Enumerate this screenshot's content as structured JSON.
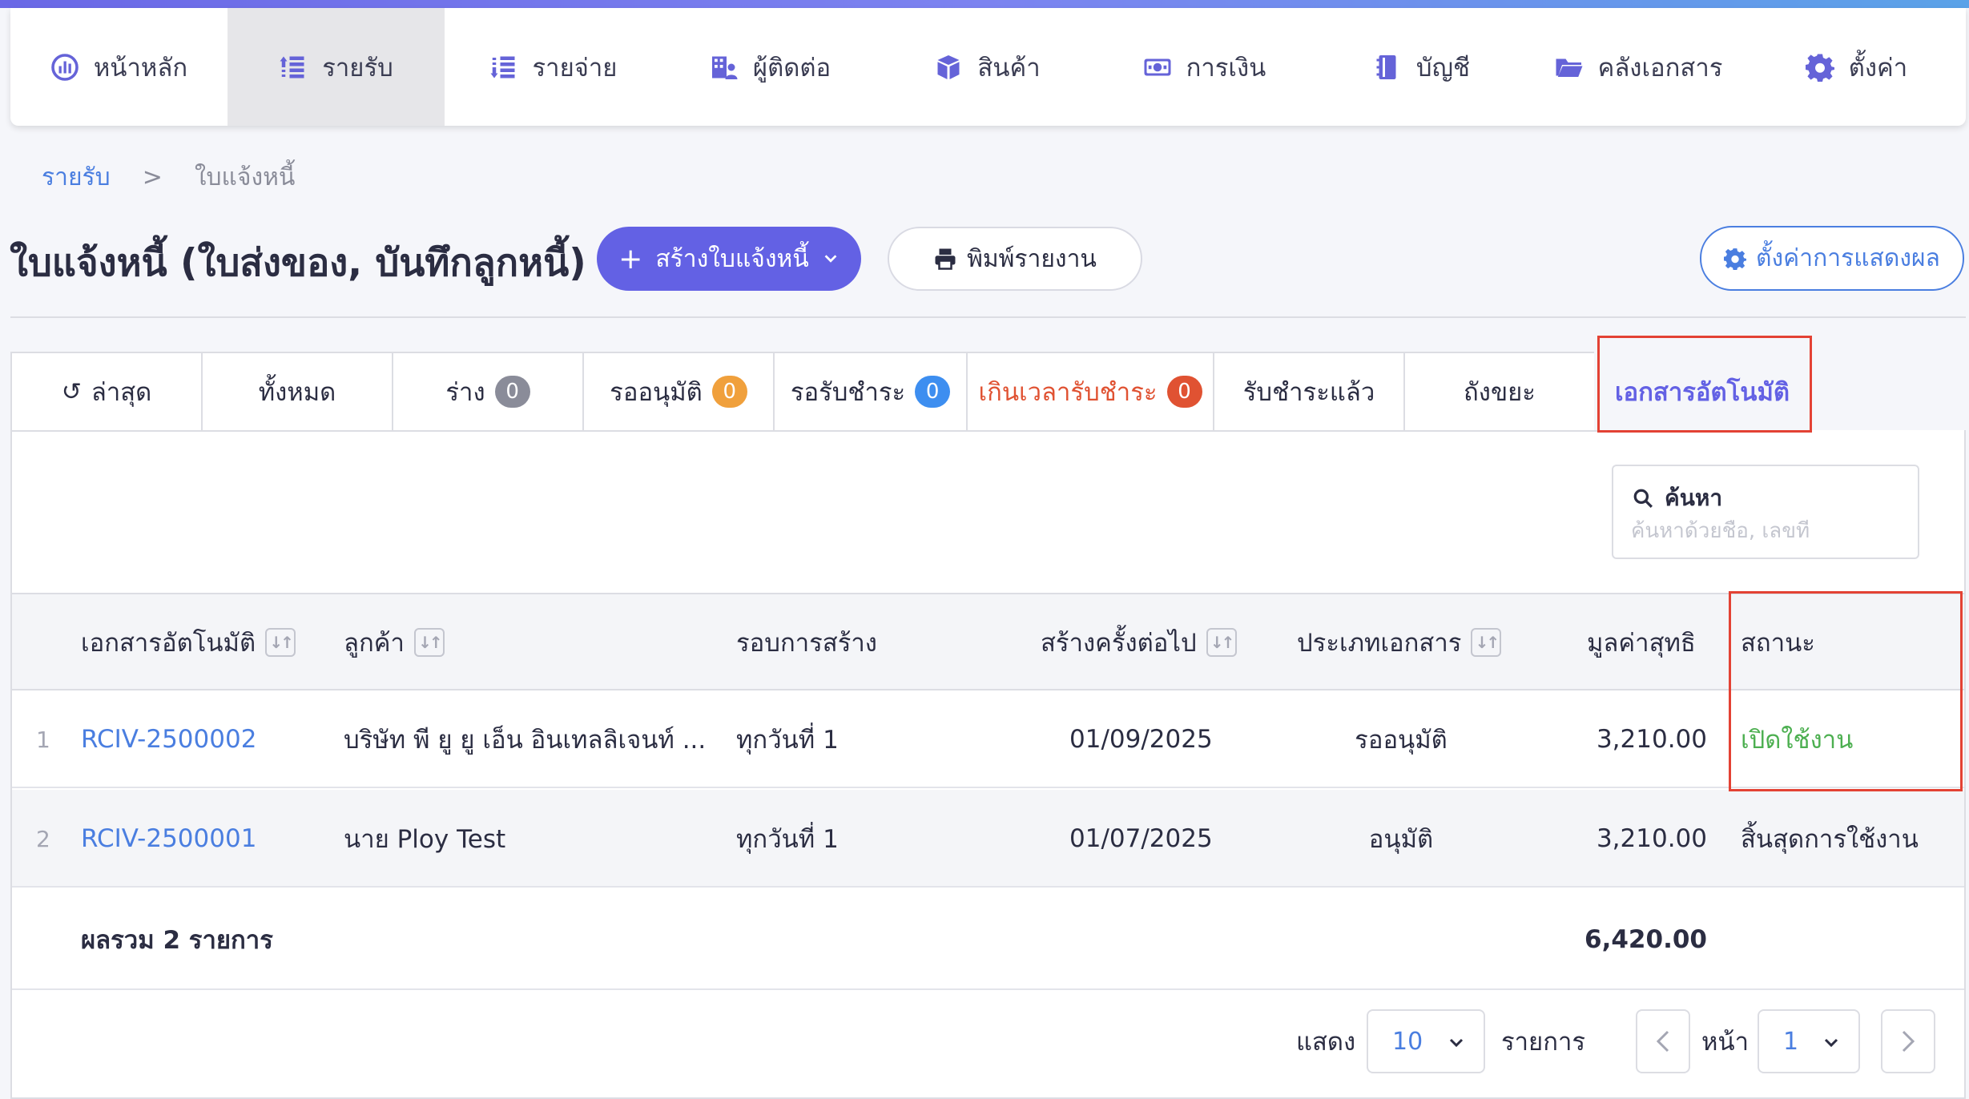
{
  "nav": {
    "items": [
      {
        "label": "หน้าหลัก",
        "icon": "dashboard-icon"
      },
      {
        "label": "รายรับ",
        "icon": "income-icon",
        "active": true
      },
      {
        "label": "รายจ่าย",
        "icon": "expense-icon"
      },
      {
        "label": "ผู้ติดต่อ",
        "icon": "contacts-icon"
      },
      {
        "label": "สินค้า",
        "icon": "box-icon"
      },
      {
        "label": "การเงิน",
        "icon": "money-icon"
      },
      {
        "label": "บัญชี",
        "icon": "book-icon"
      },
      {
        "label": "คลังเอกสาร",
        "icon": "folder-icon"
      },
      {
        "label": "ตั้งค่า",
        "icon": "gear-icon"
      }
    ]
  },
  "breadcrumb": {
    "parent": "รายรับ",
    "separator": ">",
    "current": "ใบแจ้งหนี้"
  },
  "header": {
    "title": "ใบแจ้งหนี้ (ใบส่งของ, บันทึกลูกหนี้)",
    "create_label": "สร้างใบแจ้งหนี้",
    "print_label": "พิมพ์รายงาน",
    "display_settings_label": "ตั้งค่าการแสดงผล"
  },
  "tabs": [
    {
      "label": "ล่าสุด",
      "icon": "history-icon"
    },
    {
      "label": "ทั้งหมด"
    },
    {
      "label": "ร่าง",
      "count": "0",
      "badge_color": "#8a8c99"
    },
    {
      "label": "รออนุมัติ",
      "count": "0",
      "badge_color": "#f0a03c"
    },
    {
      "label": "รอรับชำระ",
      "count": "0",
      "badge_color": "#3d8ef0"
    },
    {
      "label": "เกินเวลารับชำระ",
      "count": "0",
      "badge_color": "#e05232"
    },
    {
      "label": "รับชำระแล้ว"
    },
    {
      "label": "ถังขยะ"
    },
    {
      "label": "เอกสารอัตโนมัติ",
      "active": true
    }
  ],
  "search": {
    "label": "ค้นหา",
    "placeholder": "ค้นหาด้วยชื่อ, เลขที่"
  },
  "table": {
    "columns": [
      "เอกสารอัตโนมัติ",
      "ลูกค้า",
      "รอบการสร้าง",
      "สร้างครั้งต่อไป",
      "ประเภทเอกสาร",
      "มูลค่าสุทธิ",
      "สถานะ"
    ],
    "rows": [
      {
        "index": "1",
        "doc": "RCIV-2500002",
        "customer": "บริษัท พี ยู ยู เอ็น อินเทลลิเจนท์ ...",
        "cycle": "ทุกวันที่ 1",
        "next": "01/09/2025",
        "type": "รออนุมัติ",
        "amount": "3,210.00",
        "status": "เปิดใช้งาน"
      },
      {
        "index": "2",
        "doc": "RCIV-2500001",
        "customer": "นาย Ploy Test",
        "cycle": "ทุกวันที่ 1",
        "next": "01/07/2025",
        "type": "อนุมัติ",
        "amount": "3,210.00",
        "status": "สิ้นสุดการใช้งาน"
      }
    ],
    "total_label": "ผลรวม 2 รายการ",
    "total_amount": "6,420.00"
  },
  "pagination": {
    "show_label": "แสดง",
    "page_size": "10",
    "items_label": "รายการ",
    "page_label": "หน้า",
    "page": "1"
  },
  "colors": {
    "accent": "#6361e4",
    "link": "#4a7ee0",
    "active_status": "#4caf50",
    "highlight": "#e34234"
  }
}
